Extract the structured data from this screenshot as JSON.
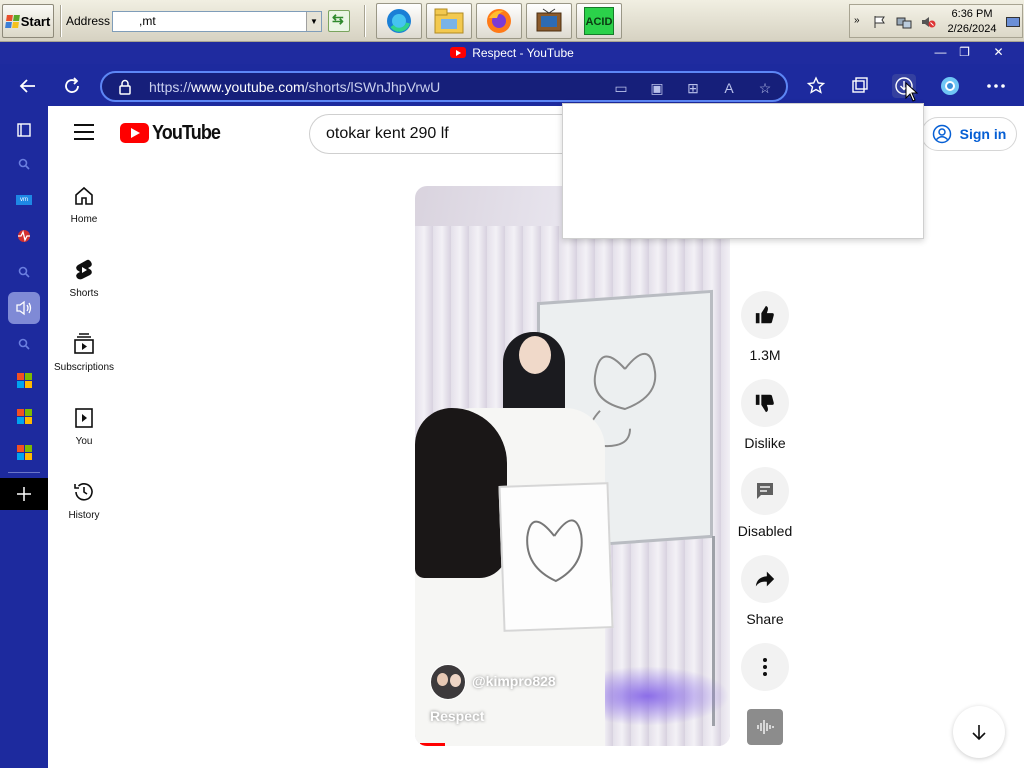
{
  "taskbar": {
    "start_label": "Start",
    "address_label": "Address",
    "address_value": ",mt",
    "quicklaunch": [
      "edge-icon",
      "file-explorer-icon",
      "firefox-icon",
      "media-icon",
      "acid-icon"
    ],
    "acid_label": "ACID",
    "clock_time": "6:36 PM",
    "clock_date": "2/26/2024"
  },
  "browser": {
    "window_title": "Respect - YouTube",
    "url_prefix": "https://",
    "url_domain": "www.youtube.com",
    "url_path": "/shorts/lSWnJhpVrwU",
    "accent": "#1d2a9e"
  },
  "youtube": {
    "search_value": "otokar kent 290 lf",
    "sign_in_label": "Sign in",
    "nav": [
      {
        "label": "Home"
      },
      {
        "label": "Shorts"
      },
      {
        "label": "Subscriptions"
      },
      {
        "label": "You"
      },
      {
        "label": "History"
      }
    ],
    "short": {
      "channel": "@kimpro828",
      "title": "Respect",
      "progress_fraction": 0.08
    },
    "actions": {
      "like_count": "1.3M",
      "dislike_label": "Dislike",
      "comments_label": "Disabled",
      "share_label": "Share"
    }
  }
}
